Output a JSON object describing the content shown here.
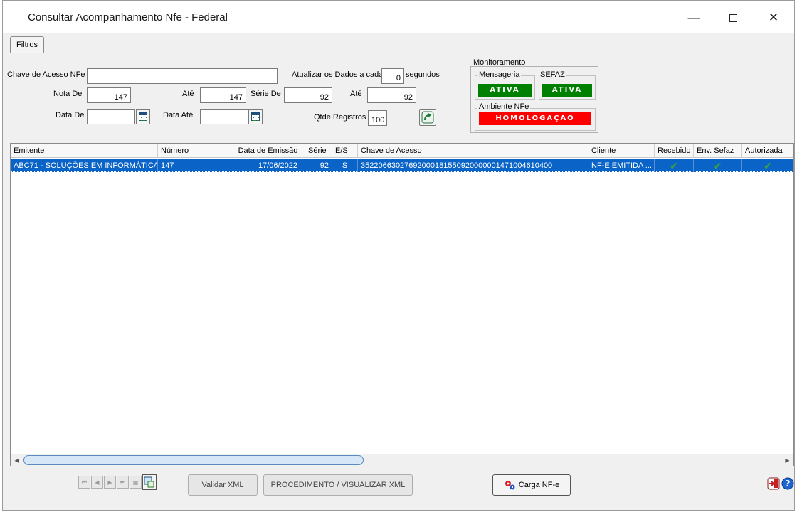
{
  "window": {
    "title": "Consultar Acompanhamento Nfe - Federal",
    "minimize_icon": "minimize-icon",
    "maximize_icon": "maximize-icon",
    "close_icon": "close-icon"
  },
  "tabs": [
    {
      "label": "Filtros"
    }
  ],
  "filters": {
    "chave_label": "Chave de Acesso NFe",
    "chave_value": "",
    "atualizar_label": "Atualizar os Dados a cada",
    "atualizar_value": "0",
    "segundos_label": "segundos",
    "nota_de_label": "Nota De",
    "nota_de_value": "147",
    "nota_ate_label": "Até",
    "nota_ate_value": "147",
    "serie_de_label": "Série De",
    "serie_de_value": "92",
    "serie_ate_label": "Até",
    "serie_ate_value": "92",
    "data_de_label": "Data De",
    "data_de_value": "",
    "data_ate_label": "Data Até",
    "data_ate_value": "",
    "qtde_label": "Qtde Registros",
    "qtde_value": "100"
  },
  "monitor": {
    "title": "Monitoramento",
    "mensageria_label": "Mensageria",
    "mensageria_status": "ATIVA",
    "sefaz_label": "SEFAZ",
    "sefaz_status": "ATIVA",
    "ambiente_label": "Ambiente NFe",
    "ambiente_status": "HOMOLOGAÇÃO",
    "colors": {
      "ativa": "#008000",
      "homologacao": "#ff0000"
    }
  },
  "grid": {
    "columns": [
      "Emitente",
      "Número",
      "Data de Emissão",
      "Série",
      "E/S",
      "Chave de Acesso",
      "Cliente",
      "Recebido",
      "Env. Sefaz",
      "Autorizada"
    ],
    "rows": [
      {
        "emitente": "ABC71 - SOLUÇÕES EM INFORMÁTICA",
        "numero": "147",
        "data_emissao": "17/06/2022",
        "serie": "92",
        "es": "S",
        "chave": "35220663027692000181550920000001471004610400",
        "cliente": "NF-E EMITIDA ...",
        "recebido": "check-icon",
        "env_sefaz": "check-icon",
        "autorizada": "check-icon"
      }
    ],
    "selected_row_color": "#0a64c8"
  },
  "buttons": {
    "validar_xml": "Validar XML",
    "procedimento": "PROCEDIMENTO / VISUALIZAR XML",
    "carga_nfe": "Carga NF-e"
  }
}
